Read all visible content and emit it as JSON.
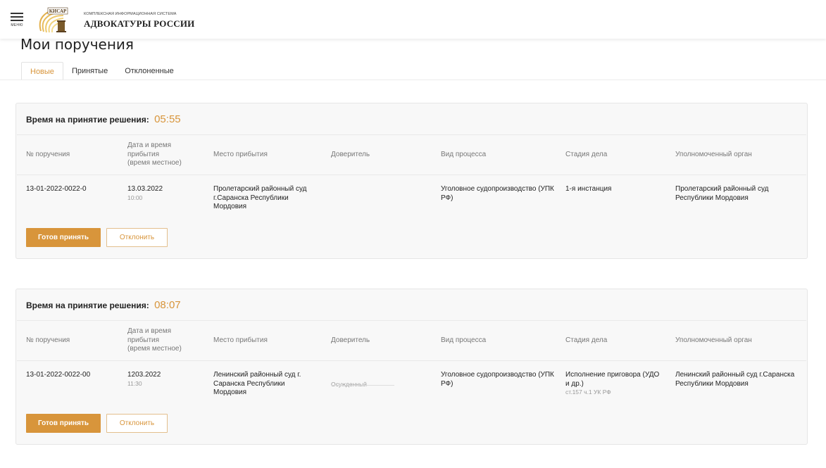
{
  "header": {
    "menu_label": "МЕНЮ",
    "logo_badge": "КИСАР",
    "subtitle": "КОМПЛЕКСНАЯ ИНФОРМАЦИОННАЯ СИСТЕМА",
    "title": "АДВОКАТУРЫ РОССИИ"
  },
  "page": {
    "title": "Мои поручения"
  },
  "tabs": [
    {
      "label": "Новые",
      "active": true
    },
    {
      "label": "Принятые",
      "active": false
    },
    {
      "label": "Отклоненные",
      "active": false
    }
  ],
  "columns": {
    "number": "№ поручения",
    "datetime_line1": "Дата и время",
    "datetime_line2": "прибытия",
    "datetime_line3": "(время местное)",
    "place": "Место прибытия",
    "principal": "Доверитель",
    "process": "Вид процесса",
    "stage": "Стадия дела",
    "authority": "Уполномоченный орган"
  },
  "cards": [
    {
      "timer_label": "Время на принятие решения:",
      "timer_value": "05:55",
      "number": "13-01-2022-0022-0",
      "date": "13.03.2022",
      "time": "10:00",
      "place": "Пролетарский районный суд г.Саранска Республики Мордовия",
      "principal": "",
      "principal_sub": "",
      "process": "Уголовное судопроизводство (УПК РФ)",
      "stage": "1-я инстанция",
      "stage_sub": "",
      "authority": "Пролетарский районный суд Республики Мордовия",
      "accept_label": "Готов принять",
      "decline_label": "Отклонить"
    },
    {
      "timer_label": "Время на принятие решения:",
      "timer_value": "08:07",
      "number": "13-01-2022-0022-00",
      "date": "1203.2022",
      "time": "11:30",
      "place": "Ленинский районный суд г. Саранска Республики Мордовия",
      "principal": "",
      "principal_sub": "Осужденный",
      "process": "Уголовное судопроизводство (УПК РФ)",
      "stage": "Исполнение приговора (УДО и др.)",
      "stage_sub": "ст.157 ч.1 УК РФ",
      "authority": "Ленинский районный суд г.Саранска Республики Мордовия",
      "accept_label": "Готов принять",
      "decline_label": "Отклонить"
    }
  ],
  "colors": {
    "accent": "#d8953b",
    "card_bg": "#f8f8f8"
  }
}
